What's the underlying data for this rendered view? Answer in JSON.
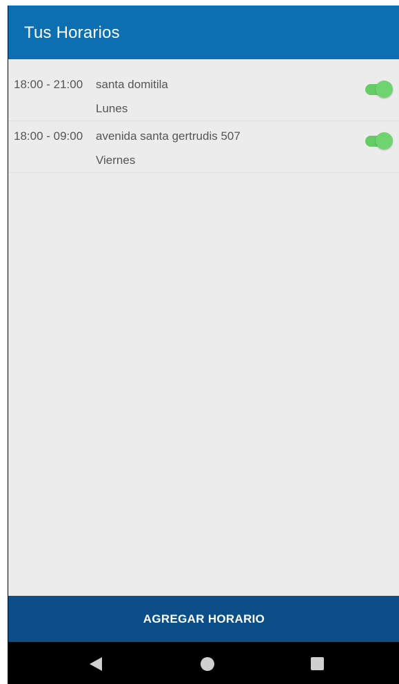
{
  "header": {
    "title": "Tus Horarios"
  },
  "schedules": [
    {
      "time": "18:00 - 21:00",
      "place": "santa domitila",
      "day": "Lunes",
      "enabled": true
    },
    {
      "time": "18:00 - 09:00",
      "place": "avenida santa gertrudis 507",
      "day": "Viernes",
      "enabled": true
    }
  ],
  "footer": {
    "add_button_label": "AGREGAR HORARIO"
  },
  "navigation_bar": {
    "back": "back-triangle-icon",
    "home": "home-circle-icon",
    "recents": "recents-square-icon"
  },
  "colors": {
    "app_bar": "#0b6fb2",
    "bottom_button": "#0b4e88",
    "toggle_on": "#66cc66",
    "background": "#ececec"
  }
}
